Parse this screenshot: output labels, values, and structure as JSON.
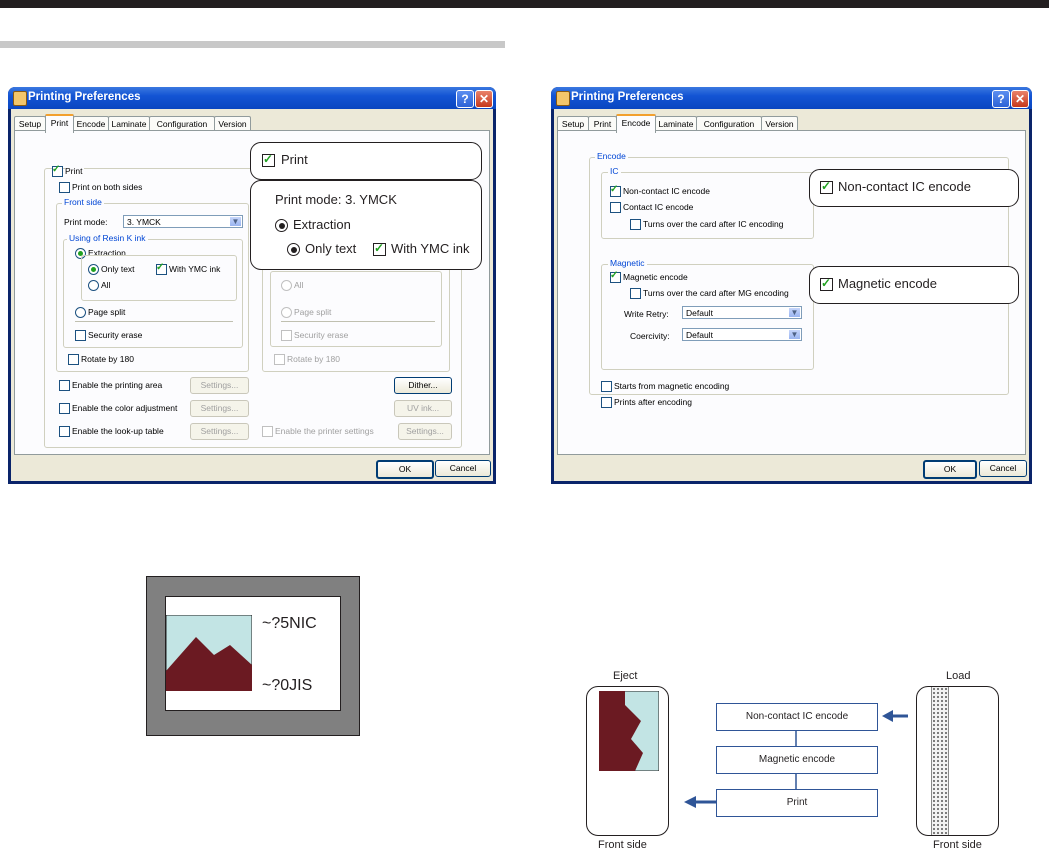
{
  "dialog_print": {
    "title": "Printing Preferences",
    "tabs": [
      "Setup",
      "Print",
      "Encode",
      "Laminate",
      "Configuration",
      "Version"
    ],
    "active_tab": "Print",
    "print_label": "Print",
    "print_both_sides": "Print on both sides",
    "front_side_label": "Front side",
    "print_mode_label": "Print mode:",
    "print_mode_value": "3. YMCK",
    "resin_group_label": "Using of Resin K ink",
    "extraction_label": "Extraction",
    "only_text_label": "Only text",
    "with_ymc_label": "With YMC ink",
    "all_label": "All",
    "page_split_label": "Page split",
    "security_erase_label": "Security erase",
    "rotate_label": "Rotate by 180",
    "all_label_back": "All",
    "page_split_back": "Page split",
    "security_erase_back": "Security erase",
    "rotate_back": "Rotate by 180",
    "enable_printing_area": "Enable the printing area",
    "enable_color_adjust": "Enable the color adjustment",
    "enable_lookup": "Enable the look-up table",
    "enable_printer_settings": "Enable the printer settings",
    "settings_btn": "Settings...",
    "dither_btn": "Dither...",
    "uv_ink_btn": "UV ink...",
    "ok_btn": "OK",
    "cancel_btn": "Cancel"
  },
  "callout_print": {
    "print_label": "Print",
    "print_mode": "Print mode:  3. YMCK",
    "extraction": "Extraction",
    "only_text": "Only text",
    "with_ymc": "With YMC ink"
  },
  "dialog_encode": {
    "title": "Printing Preferences",
    "tabs": [
      "Setup",
      "Print",
      "Encode",
      "Laminate",
      "Configuration",
      "Version"
    ],
    "active_tab": "Encode",
    "encode_group": "Encode",
    "ic_group": "IC",
    "non_contact_ic": "Non-contact IC encode",
    "contact_ic": "Contact IC encode",
    "turn_over_ic": "Turns over the card after IC encoding",
    "magnetic_group": "Magnetic",
    "magnetic_encode": "Magnetic encode",
    "turn_over_mg": "Turns over the card after MG encoding",
    "write_retry_label": "Write Retry:",
    "write_retry_value": "Default",
    "coercivity_label": "Coercivity:",
    "coercivity_value": "Default",
    "starts_from_magnetic": "Starts from magnetic encoding",
    "prints_after_encoding": "Prints after encoding",
    "ok_btn": "OK",
    "cancel_btn": "Cancel"
  },
  "callout_encode": {
    "non_contact_ic": "Non-contact IC encode",
    "magnetic_encode": "Magnetic encode"
  },
  "card_illustration": {
    "line1": "~?5NIC",
    "line2": "~?0JIS"
  },
  "flow_diagram": {
    "eject_label": "Eject",
    "load_label": "Load",
    "front_side_left": "Front side",
    "front_side_right": "Front side",
    "steps": [
      "Non-contact IC encode",
      "Magnetic encode",
      "Print"
    ]
  },
  "colors": {
    "xp_title": "#0a46c0",
    "dialog_face": "#ece9d8",
    "card_gray": "#808080",
    "image_bg": "#c2e4e4",
    "mountain": "#6b1a22",
    "flow_blue": "#2f5597"
  }
}
